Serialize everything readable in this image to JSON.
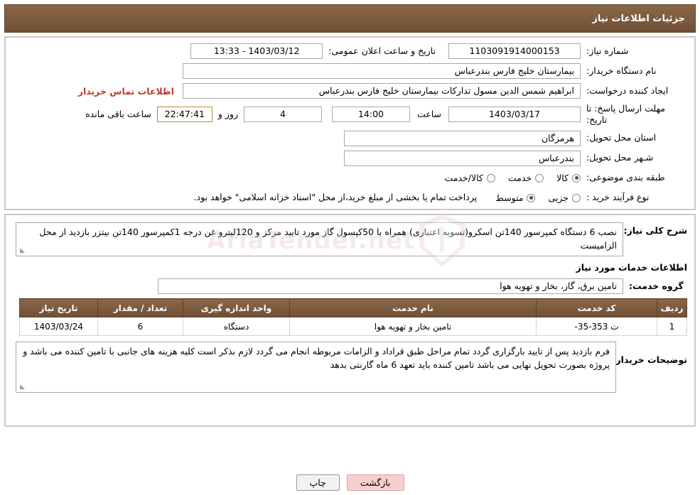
{
  "header": {
    "title": "جزئیات اطلاعات نیاز"
  },
  "form": {
    "need_number_label": "شماره نیاز:",
    "need_number_value": "1103091914000153",
    "announce_datetime_label": "تاریخ و ساعت اعلان عمومی:",
    "announce_datetime_value": "1403/03/12 - 13:33",
    "buyer_org_label": "نام دستگاه خریدار:",
    "buyer_org_value": "بیمارستان خلیج فارس بندرعباس",
    "requester_label": "ایجاد کننده درخواست:",
    "requester_value": "ابراهیم شمس الدین مسول تدارکات بیمارستان خلیج فارس بندرعباس",
    "buyer_contact_link": "اطلاعات تماس خریدار",
    "deadline_label": "مهلت ارسال پاسخ: تا تاریخ:",
    "deadline_date": "1403/03/17",
    "hour_label": "ساعت",
    "deadline_time": "14:00",
    "days_value": "4",
    "days_and_label": "روز و",
    "remaining_time": "22:47:41",
    "remaining_label": "ساعت باقی مانده",
    "province_label": "استان محل تحویل:",
    "province_value": "هرمزگان",
    "city_label": "شـهر محل تحویل:",
    "city_value": "بندرعباس",
    "category_label": "طبقه بندی موضوعی:",
    "category_options": [
      {
        "label": "کالا",
        "checked": true
      },
      {
        "label": "خدمت",
        "checked": false
      },
      {
        "label": "کالا/خدمت",
        "checked": false
      }
    ],
    "purchase_type_label": "نوع فرآیند خرید :",
    "purchase_type_options": [
      {
        "label": "جزیی",
        "checked": false
      },
      {
        "label": "متوسط",
        "checked": true
      }
    ],
    "purchase_note": "پرداخت تمام یا بخشی از مبلغ خرید،از محل \"اسناد خزانه اسلامی\" خواهد بود."
  },
  "description": {
    "label": "شرح کلی نیاز:",
    "text": "نصب 6 دستگاه کمپرسور 140تن اسکرو(تسویه اعتباری) همراه با 50کپسول گاز مورد تایید مرکز و 120لیترو غن درجه 1کمپرسور 140تن بیتزر بازدید از محل الزامیست"
  },
  "services": {
    "section_title": "اطلاعات خدمات مورد نیاز",
    "group_label": "گروه خدمت:",
    "group_value": "تامین برق، گاز، بخار و تهویه هوا",
    "columns": [
      "ردیف",
      "کد خدمت",
      "نام خدمت",
      "واحد اندازه گیری",
      "تعداد / مقدار",
      "تاریخ نیاز"
    ],
    "rows": [
      {
        "index": "1",
        "code": "ت 353-35-",
        "name": "تامین بخار و تهویه هوا",
        "unit": "دستگاه",
        "qty": "6",
        "date": "1403/03/24"
      }
    ]
  },
  "buyer_notes": {
    "label": "توضیحات خریدار:",
    "text": "فرم بازدید پس از تایید بارگزاری گردد تمام مراحل طبق قراداد و الزامات مربوطه انجام می گردد لازم بذکر است کلیه هزینه های جانبی با تامین کننده می باشد و پروژه بصورت تحویل نهایی می باشد تامین کننده باید تعهد 6 ماه گارنتی بدهد"
  },
  "footer": {
    "print_label": "چاپ",
    "back_label": "بازگشت"
  },
  "watermark": {
    "text": "AriaTender.net"
  }
}
